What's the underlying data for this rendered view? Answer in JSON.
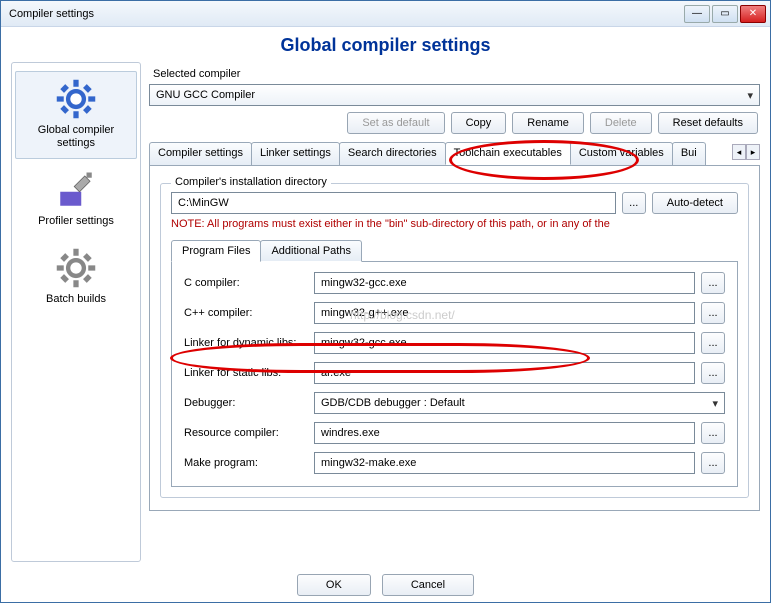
{
  "window": {
    "title": "Compiler settings"
  },
  "page_title": "Global compiler settings",
  "sidebar": {
    "items": [
      {
        "label": "Global compiler settings"
      },
      {
        "label": "Profiler settings"
      },
      {
        "label": "Batch builds"
      }
    ]
  },
  "selected_compiler": {
    "label": "Selected compiler",
    "value": "GNU GCC Compiler"
  },
  "compiler_buttons": {
    "set_default": "Set as default",
    "copy": "Copy",
    "rename": "Rename",
    "delete": "Delete",
    "reset": "Reset defaults"
  },
  "tabs": [
    "Compiler settings",
    "Linker settings",
    "Search directories",
    "Toolchain executables",
    "Custom variables",
    "Bui"
  ],
  "install_dir": {
    "group_title": "Compiler's installation directory",
    "path": "C:\\MinGW",
    "browse": "...",
    "autodetect": "Auto-detect",
    "note": "NOTE: All programs must exist either in the \"bin\" sub-directory of this path, or in any of the"
  },
  "inner_tabs": {
    "program_files": "Program Files",
    "additional_paths": "Additional Paths"
  },
  "fields": {
    "c_compiler": {
      "label": "C compiler:",
      "value": "mingw32-gcc.exe"
    },
    "cpp_compiler": {
      "label": "C++ compiler:",
      "value": "mingw32-g++.exe"
    },
    "linker_dyn": {
      "label": "Linker for dynamic libs:",
      "value": "mingw32-gcc.exe"
    },
    "linker_static": {
      "label": "Linker for static libs:",
      "value": "ar.exe"
    },
    "debugger": {
      "label": "Debugger:",
      "value": "GDB/CDB debugger : Default"
    },
    "rc": {
      "label": "Resource compiler:",
      "value": "windres.exe"
    },
    "make": {
      "label": "Make program:",
      "value": "mingw32-make.exe"
    }
  },
  "browse_label": "...",
  "bottom": {
    "ok": "OK",
    "cancel": "Cancel"
  },
  "watermark": "http://blog.csdn.net/"
}
